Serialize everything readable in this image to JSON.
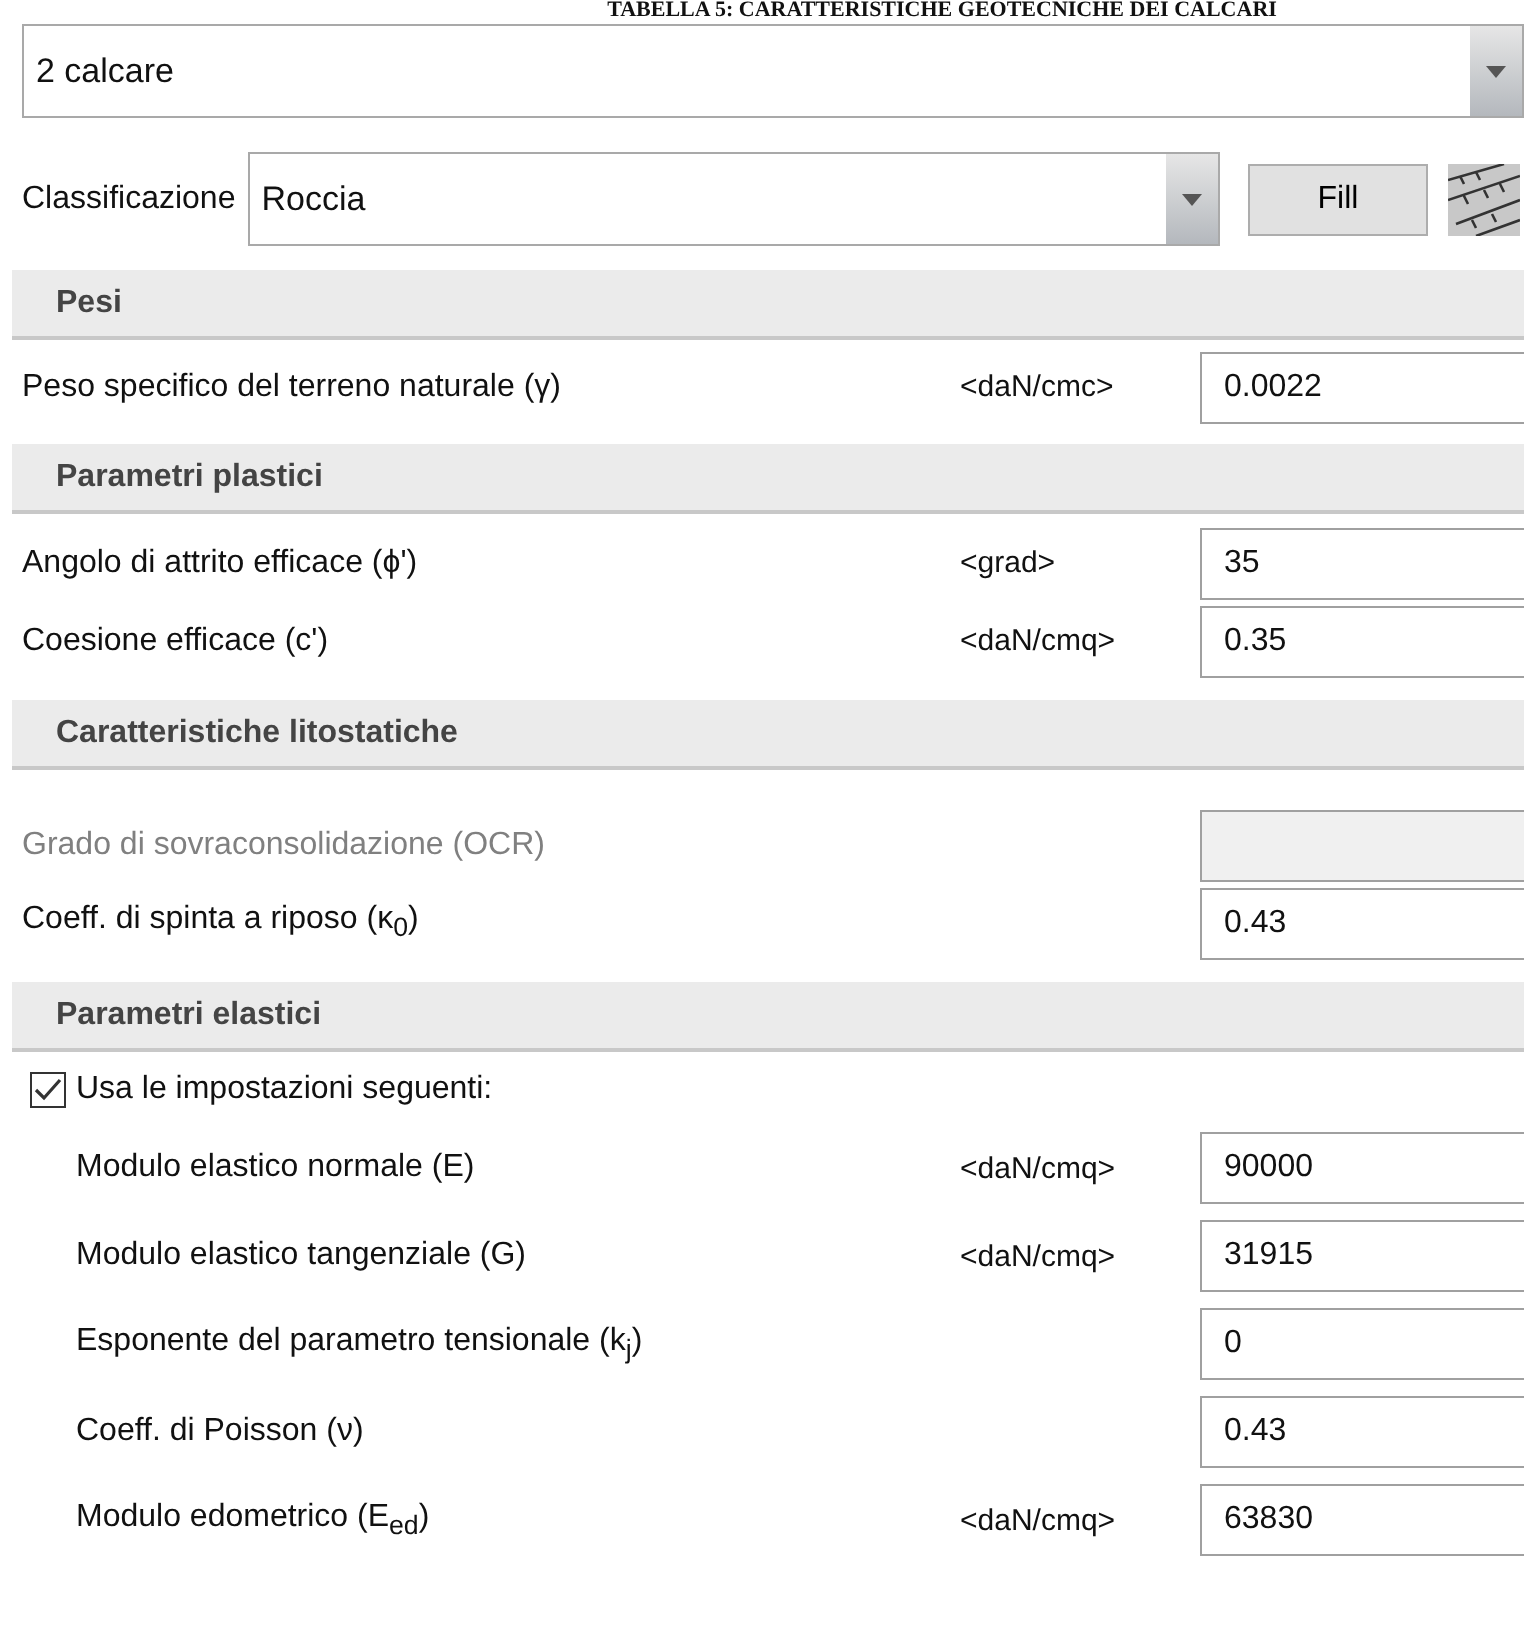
{
  "caption": "TABELLA 5: CARATTERISTICHE GEOTECNICHE DEI CALCARI",
  "material": {
    "value": "2 calcare"
  },
  "classification": {
    "label": "Classificazione",
    "value": "Roccia",
    "button": "Fill"
  },
  "sections": [
    {
      "title": "Pesi",
      "rows": [
        {
          "label": "Peso specifico del terreno naturale (γ)",
          "unit": "<daN/cmc>",
          "value": "0.0022",
          "disabled": false
        }
      ]
    },
    {
      "title": "Parametri plastici",
      "rows": [
        {
          "label": "Angolo di attrito efficace (ϕ')",
          "unit": "<grad>",
          "value": "35",
          "disabled": false
        },
        {
          "label": "Coesione efficace (c')",
          "unit": "<daN/cmq>",
          "value": "0.35",
          "disabled": false
        }
      ]
    },
    {
      "title": "Caratteristiche litostatiche",
      "rows": [
        {
          "label": "Grado di sovraconsolidazione (OCR)",
          "disabled": true
        },
        {
          "label": "Coeff. di spinta a riposo (κ$_{0}$)",
          "value": "0.43",
          "disabled": false
        }
      ]
    },
    {
      "title": "Parametri elastici",
      "checkbox": {
        "label": "Usa le impostazioni seguenti:",
        "checked": true
      },
      "rows": [
        {
          "label": "Modulo elastico normale (E)",
          "unit": "<daN/cmq>",
          "value": "90000",
          "disabled": false
        },
        {
          "label": "Modulo elastico tangenziale (G)",
          "unit": "<daN/cmq>",
          "value": "31915",
          "disabled": false
        },
        {
          "label": "Esponente del parametro tensionale (k$_{j}$)",
          "value": "0",
          "disabled": false
        },
        {
          "label": "Coeff. di Poisson (ν)",
          "value": "0.43",
          "disabled": false
        },
        {
          "label": "Modulo edometrico (E$_{ed}$)",
          "unit": "<daN/cmq>",
          "value": "63830",
          "disabled": false
        }
      ]
    }
  ]
}
